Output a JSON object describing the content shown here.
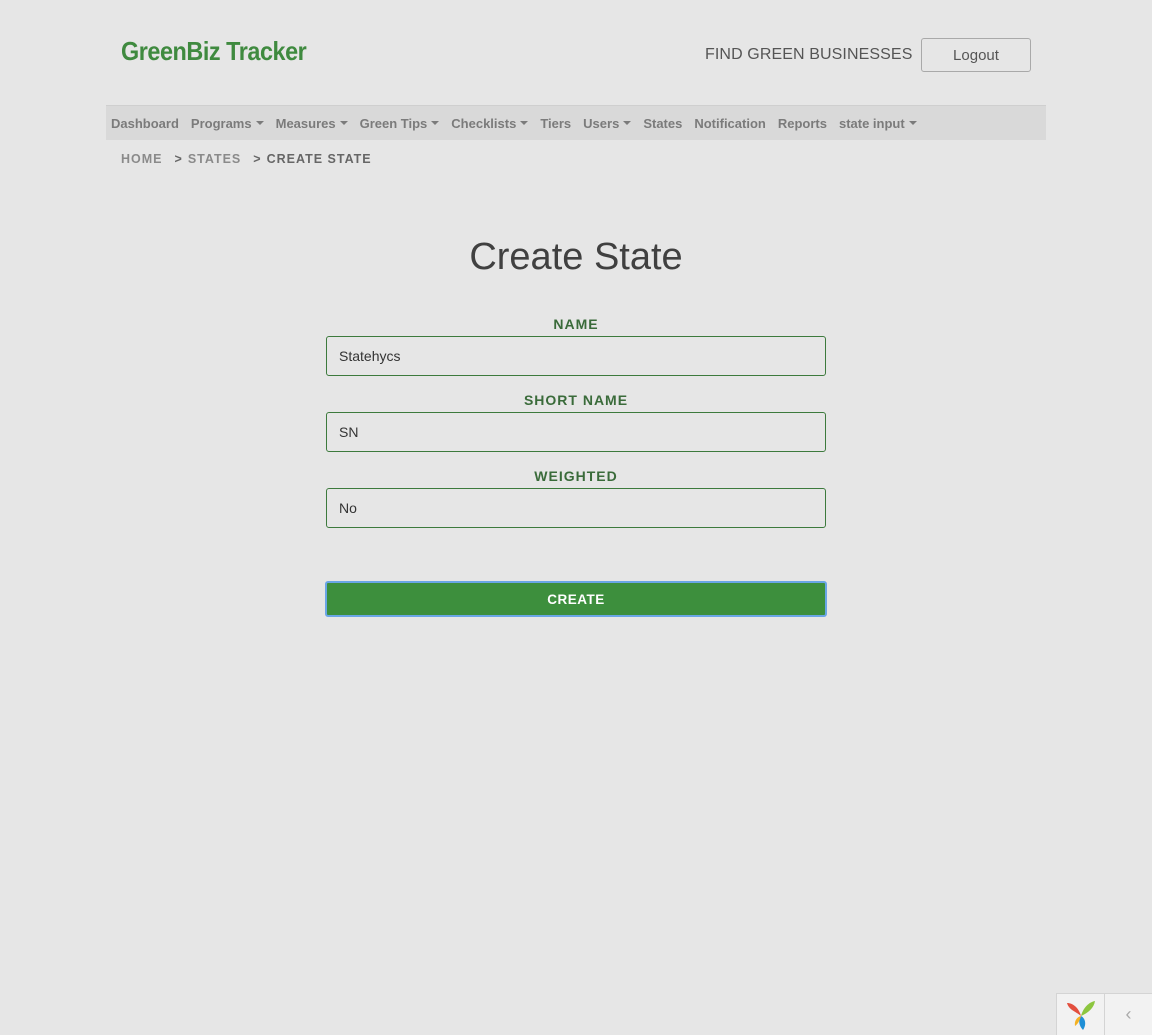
{
  "header": {
    "logo_text": "GreenBiz Tracker",
    "find_link": "FIND GREEN BUSINESSES",
    "logout_label": "Logout"
  },
  "nav": {
    "items": [
      {
        "label": "Dashboard",
        "dropdown": false
      },
      {
        "label": "Programs",
        "dropdown": true
      },
      {
        "label": "Measures",
        "dropdown": true
      },
      {
        "label": "Green Tips",
        "dropdown": true
      },
      {
        "label": "Checklists",
        "dropdown": true
      },
      {
        "label": "Tiers",
        "dropdown": false
      },
      {
        "label": "Users",
        "dropdown": true
      },
      {
        "label": "States",
        "dropdown": false
      },
      {
        "label": "Notification",
        "dropdown": false
      },
      {
        "label": "Reports",
        "dropdown": false
      },
      {
        "label": "state input",
        "dropdown": true
      }
    ]
  },
  "breadcrumb": {
    "home": "HOME",
    "states": "STATES",
    "current": "CREATE STATE",
    "separator": ">"
  },
  "form": {
    "title": "Create State",
    "name_label": "NAME",
    "name_value": "Statehycs",
    "short_name_label": "SHORT NAME",
    "short_name_value": "SN",
    "weighted_label": "WEIGHTED",
    "weighted_value": "No",
    "submit_label": "CREATE"
  },
  "debug_toolbar": {
    "logo_icon": "yii-logo-icon",
    "toggle_icon": "chevron-left-icon",
    "toggle_glyph": "‹"
  },
  "colors": {
    "background": "#e6e6e6",
    "brand_green": "#3f8a3f",
    "label_green": "#3a6b3a",
    "button_green": "#3d8f3d",
    "focus_ring": "#6aa6e6"
  }
}
